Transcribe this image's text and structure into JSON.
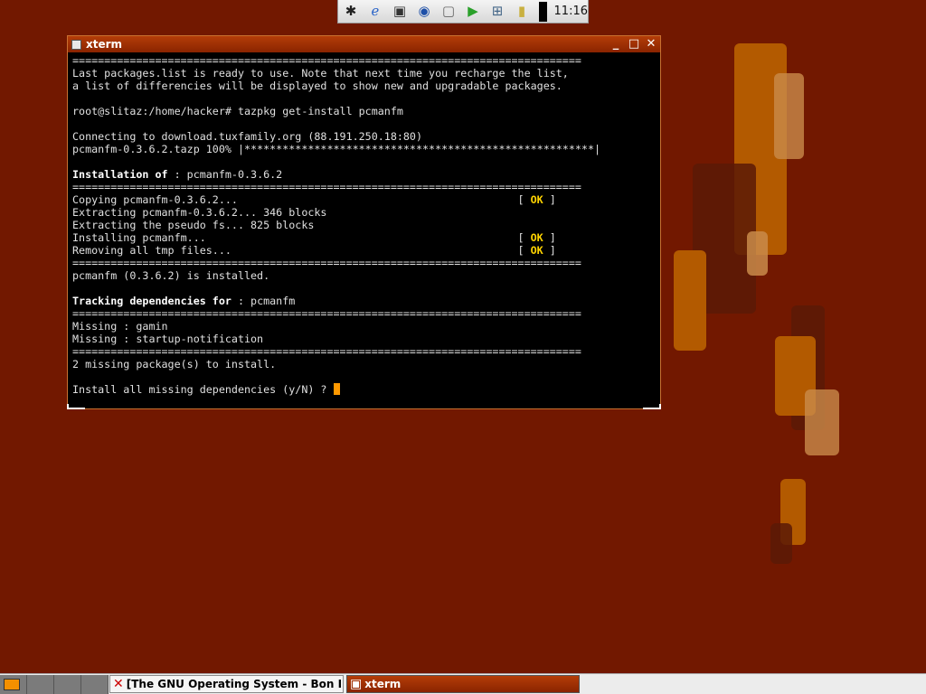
{
  "top_panel": {
    "launchers": [
      {
        "name": "spider-icon",
        "glyph": "✱",
        "color": "#222222"
      },
      {
        "name": "web-browser-icon",
        "glyph": "ℯ",
        "color": "#2a64c8"
      },
      {
        "name": "terminal-icon",
        "glyph": "▣",
        "color": "#333333"
      },
      {
        "name": "globe-icon",
        "glyph": "◉",
        "color": "#1d4fa8"
      },
      {
        "name": "image-viewer-icon",
        "glyph": "▢",
        "color": "#666666"
      },
      {
        "name": "media-play-icon",
        "glyph": "▶",
        "color": "#2aa02a"
      },
      {
        "name": "network-icon",
        "glyph": "⊞",
        "color": "#446688"
      },
      {
        "name": "battery-icon",
        "glyph": "▮",
        "color": "#c9b040"
      }
    ],
    "clock": "11:16"
  },
  "xterm": {
    "title": "xterm",
    "minimize": "_",
    "maximize": "□",
    "close": "✕",
    "lines": [
      [
        {
          "t": "================================================================================"
        }
      ],
      [
        {
          "t": "Last packages.list is ready to use. Note that next time you recharge the list,"
        }
      ],
      [
        {
          "t": "a list of differencies will be displayed to show new and upgradable packages."
        }
      ],
      [
        {
          "t": ""
        }
      ],
      [
        {
          "t": "root@slitaz:/home/hacker# tazpkg get-install pcmanfm"
        }
      ],
      [
        {
          "t": ""
        }
      ],
      [
        {
          "t": "Connecting to download.tuxfamily.org (88.191.250.18:80)"
        }
      ],
      [
        {
          "t": "pcmanfm-0.3.6.2.tazp 100% |*******************************************************|"
        }
      ],
      [
        {
          "t": ""
        }
      ],
      [
        {
          "t": "Installation of",
          "s": "bold"
        },
        {
          "t": " : pcmanfm-0.3.6.2"
        }
      ],
      [
        {
          "t": "================================================================================"
        }
      ],
      [
        {
          "t": "Copying pcmanfm-0.3.6.2...                                            [ "
        },
        {
          "t": "OK",
          "s": "ok"
        },
        {
          "t": " ]"
        }
      ],
      [
        {
          "t": "Extracting pcmanfm-0.3.6.2... 346 blocks"
        }
      ],
      [
        {
          "t": "Extracting the pseudo fs... 825 blocks"
        }
      ],
      [
        {
          "t": "Installing pcmanfm...                                                 [ "
        },
        {
          "t": "OK",
          "s": "ok"
        },
        {
          "t": " ]"
        }
      ],
      [
        {
          "t": "Removing all tmp files...                                             [ "
        },
        {
          "t": "OK",
          "s": "ok"
        },
        {
          "t": " ]"
        }
      ],
      [
        {
          "t": "================================================================================"
        }
      ],
      [
        {
          "t": "pcmanfm (0.3.6.2) is installed."
        }
      ],
      [
        {
          "t": ""
        }
      ],
      [
        {
          "t": "Tracking dependencies for",
          "s": "bold"
        },
        {
          "t": " : pcmanfm"
        }
      ],
      [
        {
          "t": "================================================================================"
        }
      ],
      [
        {
          "t": "Missing : gamin"
        }
      ],
      [
        {
          "t": "Missing : startup-notification"
        }
      ],
      [
        {
          "t": "================================================================================"
        }
      ],
      [
        {
          "t": "2 missing package(s) to install."
        }
      ],
      [
        {
          "t": ""
        }
      ],
      [
        {
          "t": "Install all missing dependencies (y/N) ? "
        }
      ]
    ]
  },
  "taskbar": {
    "tasks": [
      {
        "name": "task-browser",
        "icon": "✕",
        "label": "[The GNU Operating System - Bon I"
      },
      {
        "name": "task-xterm",
        "icon": "▣",
        "label": "xterm"
      }
    ]
  },
  "colors": {
    "desktop": "#721800",
    "titlebar": "#a43008",
    "ok_text": "#ffd400",
    "cursor": "#ff9900"
  }
}
